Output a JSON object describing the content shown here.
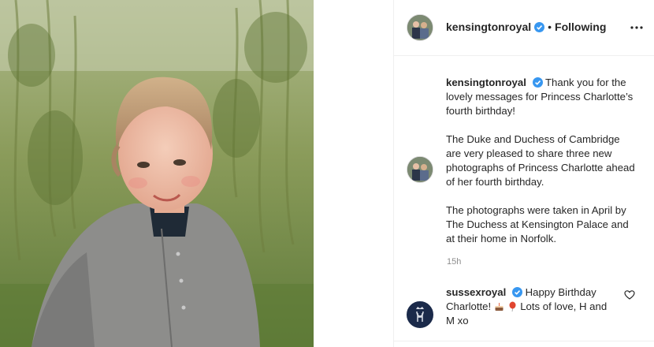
{
  "photo": {
    "icon": "photo-of-girl-in-grey-cardigan"
  },
  "post": {
    "author": "kensingtonroyal",
    "dot": "•",
    "follow_state": "Following",
    "caption_paragraphs": [
      "Thank you for the lovely messages for Princess Charlotte’s fourth birthday!",
      "The Duke and Duchess of Cambridge are very pleased to share three new photographs of Princess Charlotte ahead of her fourth birthday.",
      "The photographs were taken in April by The Duchess at Kensington Palace and at their home in Norfolk."
    ],
    "time": "15h"
  },
  "comment": {
    "author": "sussexroyal",
    "text_part1": "Happy Birthday Charlotte!",
    "text_part2": "Lots of love, H and M xo",
    "emojis": [
      "cake-emoji",
      "balloon-emoji"
    ]
  },
  "colors": {
    "verified": "#3897f0",
    "muted": "#8e8e8e",
    "border": "#efefef"
  }
}
